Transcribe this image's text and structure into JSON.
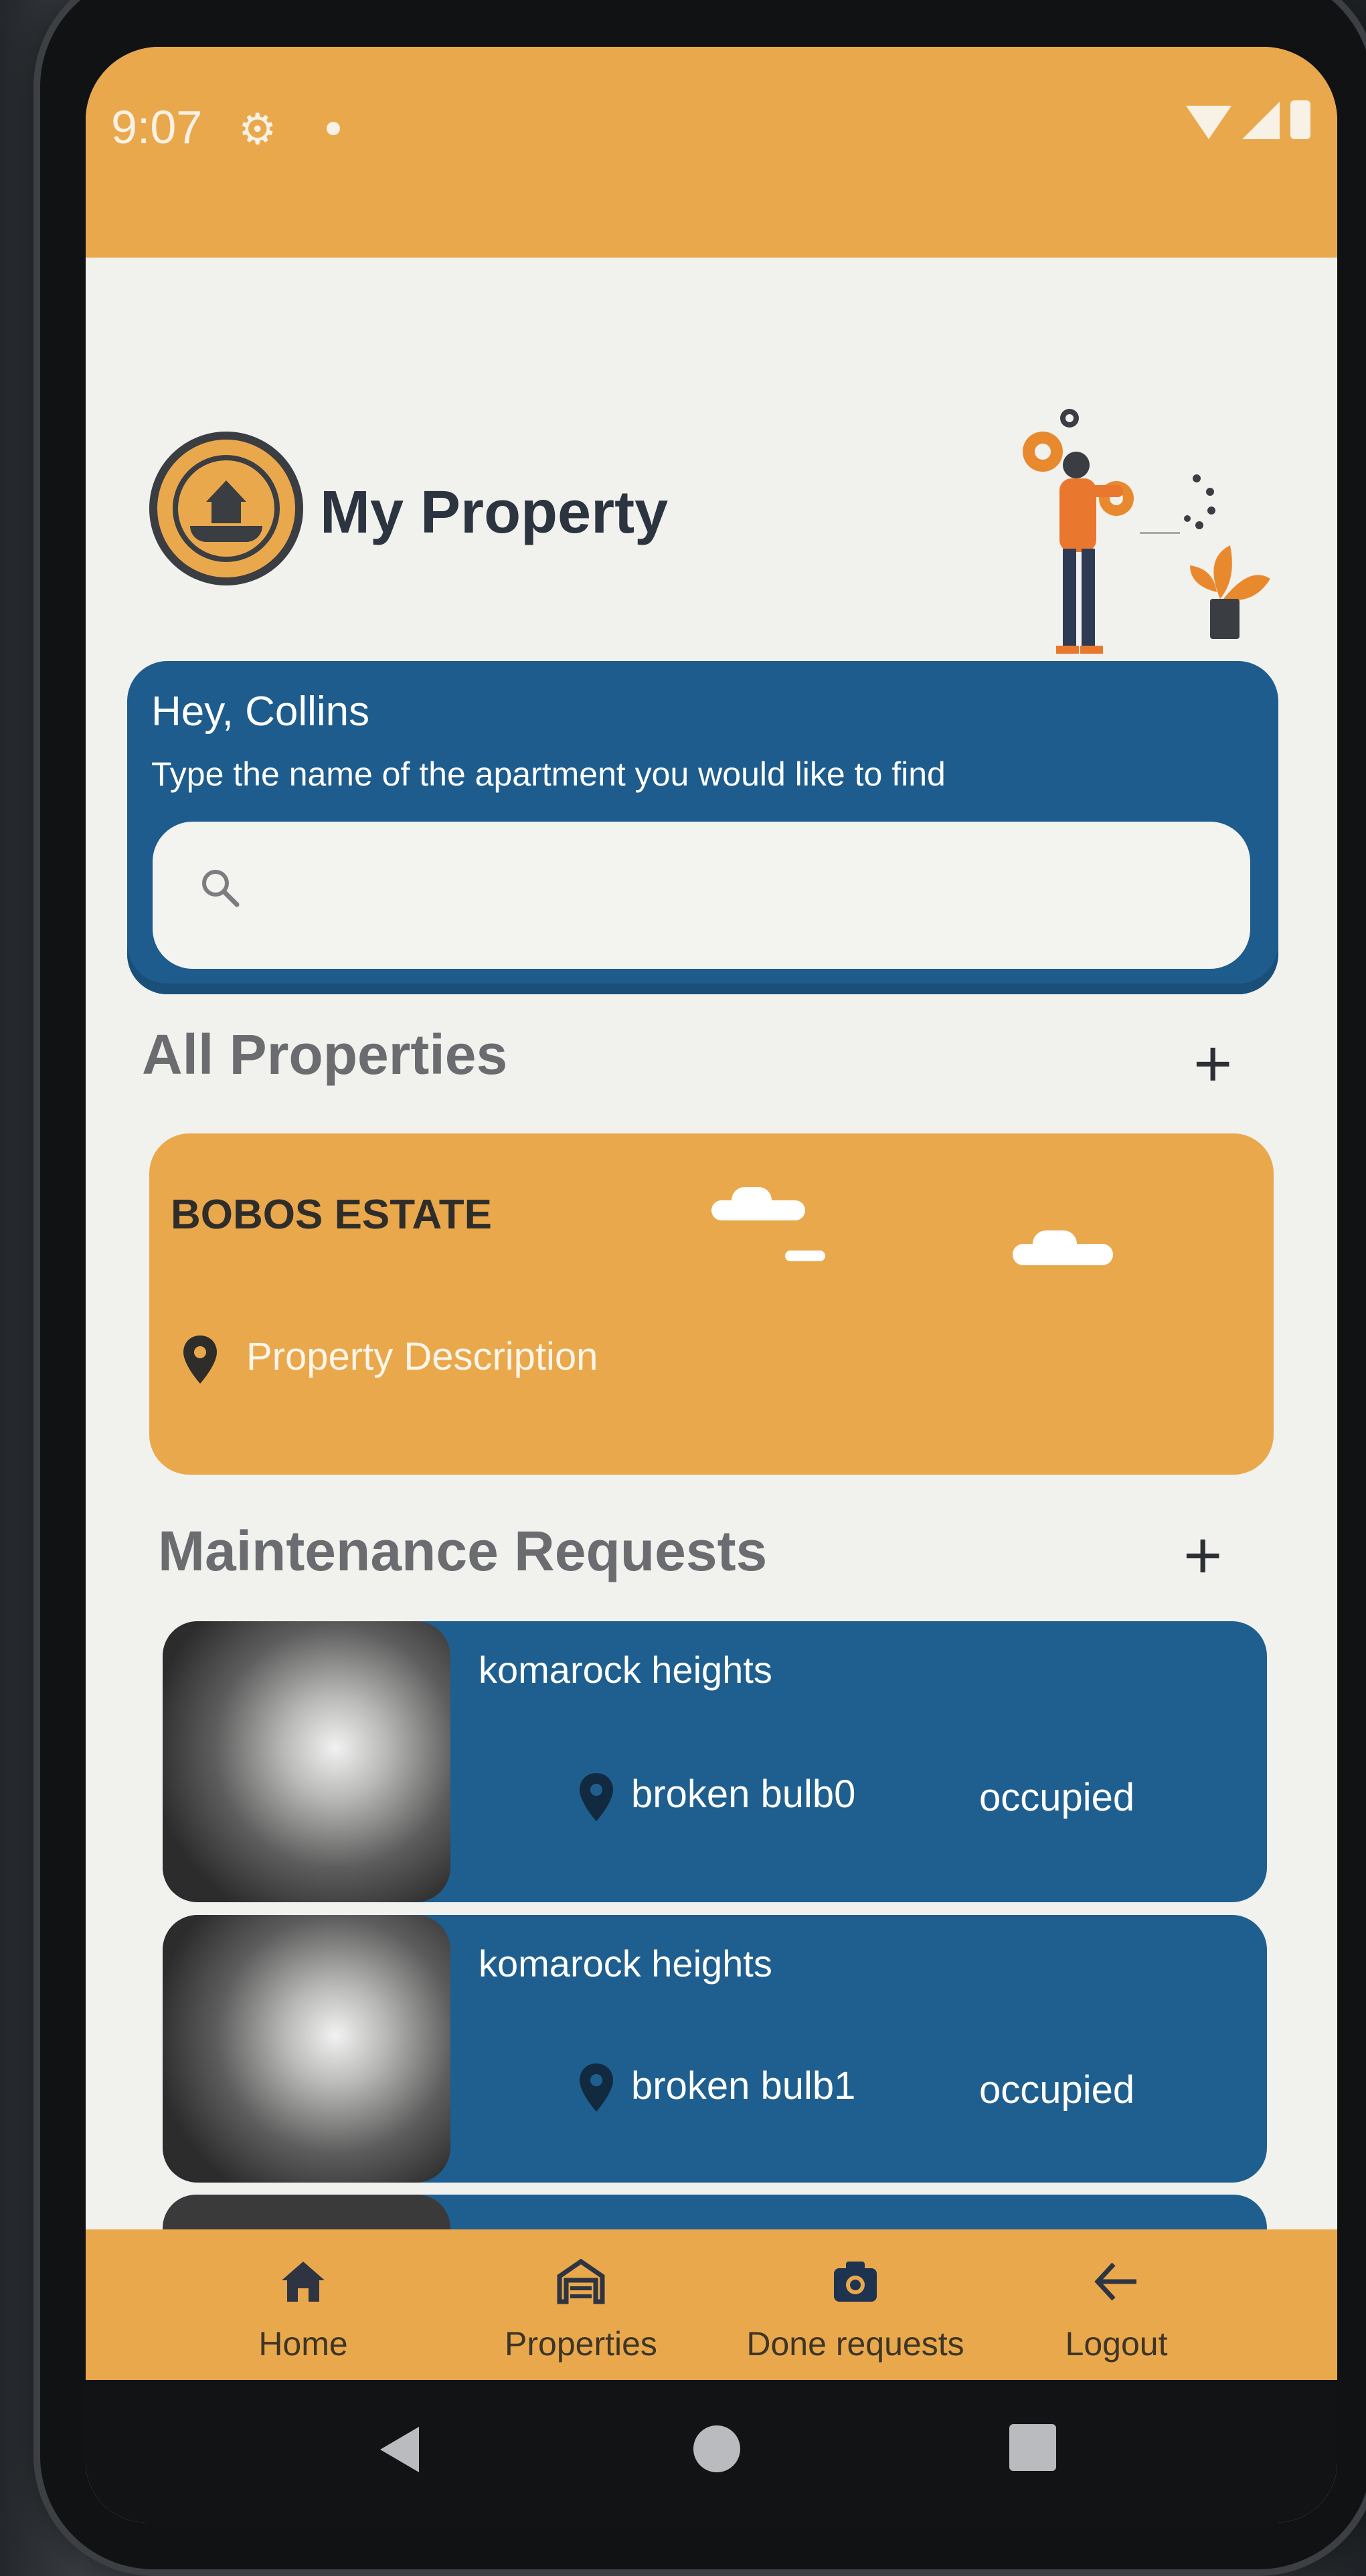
{
  "status_bar": {
    "time": "9:07"
  },
  "header": {
    "app_title": "My Property"
  },
  "search_card": {
    "greeting": "Hey, Collins",
    "subtitle": "Type the name of the apartment you would like to find",
    "search_placeholder": ""
  },
  "sections": {
    "properties_title": "All Properties",
    "maintenance_title": "Maintenance Requests",
    "add_symbol": "+"
  },
  "properties": [
    {
      "name": "BOBOS ESTATE",
      "description": "Property Description"
    }
  ],
  "maintenance_requests": [
    {
      "title": "komarock heights",
      "issue": "broken bulb0",
      "status": "occupied"
    },
    {
      "title": "komarock heights",
      "issue": "broken bulb1",
      "status": "occupied"
    }
  ],
  "bottom_nav": [
    {
      "label": "Home",
      "icon": "home-icon"
    },
    {
      "label": "Properties",
      "icon": "warehouse-icon"
    },
    {
      "label": "Done requests",
      "icon": "camera-icon"
    },
    {
      "label": "Logout",
      "icon": "arrow-left-icon"
    }
  ],
  "colors": {
    "accent_orange": "#eaa84d",
    "primary_blue": "#1d5c8c",
    "background": "#f1f1ee"
  }
}
